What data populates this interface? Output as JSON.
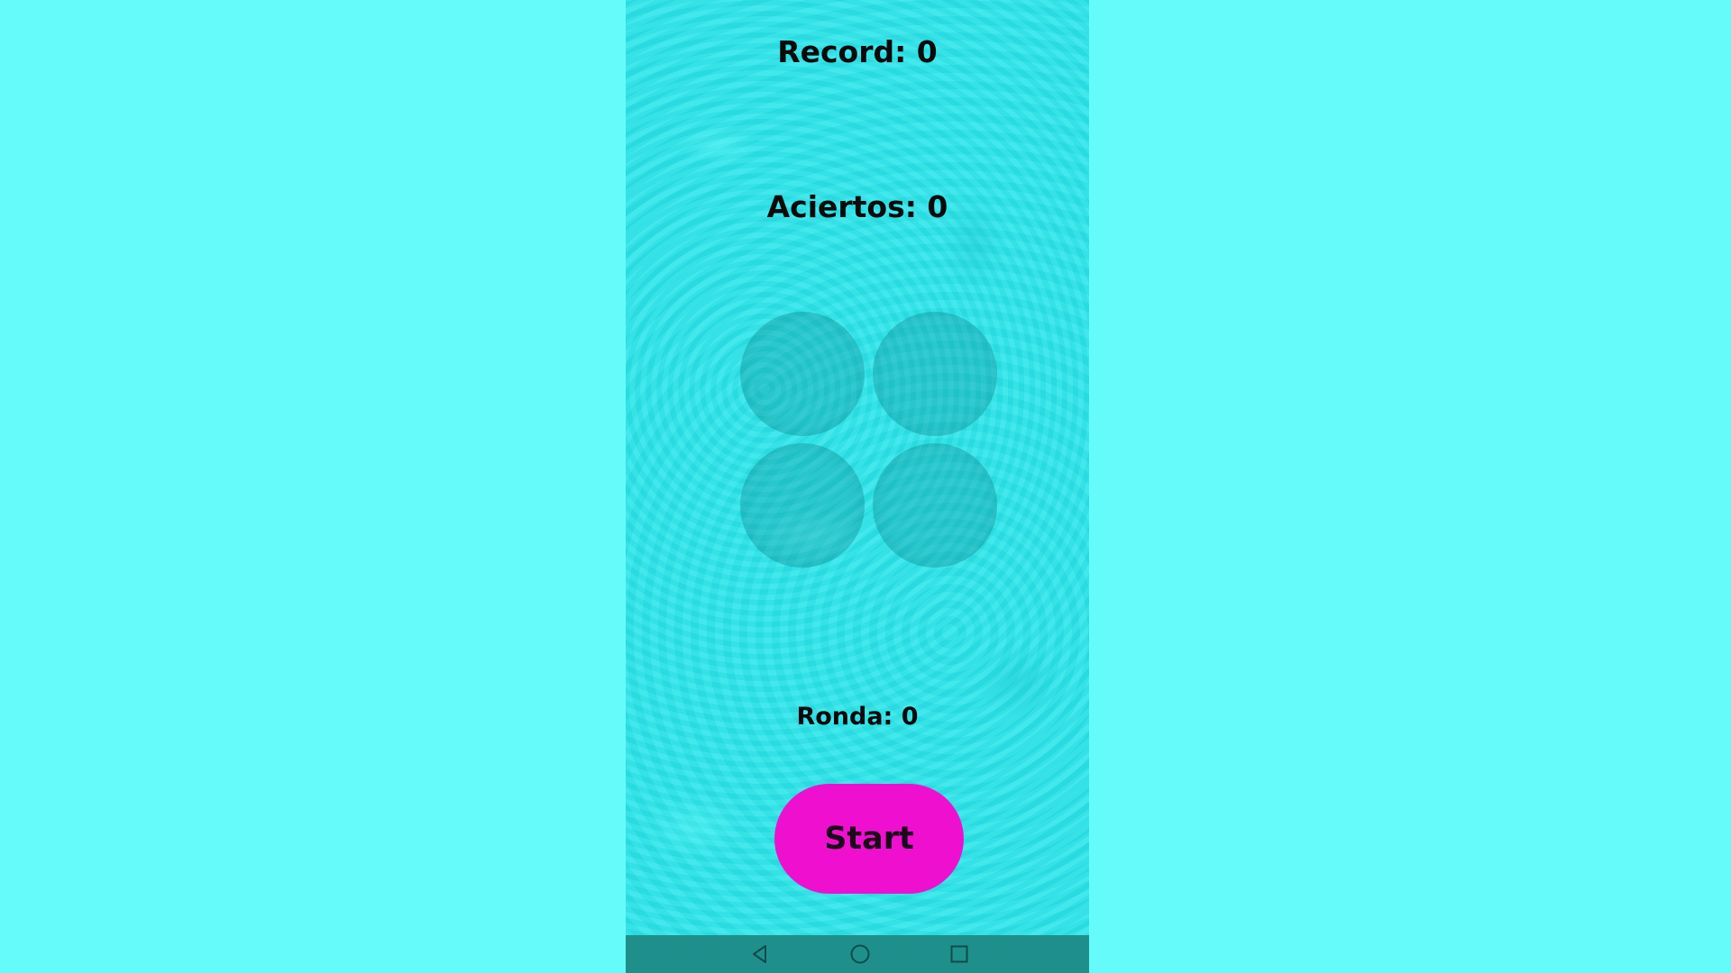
{
  "scoreboard": {
    "record_text": "Record: 0",
    "aciertos_text": "Aciertos: 0",
    "ronda_text": "Ronda: 0"
  },
  "game": {
    "pads": [
      "pad-top-left",
      "pad-top-right",
      "pad-bottom-left",
      "pad-bottom-right"
    ]
  },
  "controls": {
    "start_label": "Start"
  },
  "navigation_bar": {
    "icons": [
      "back-icon",
      "home-icon",
      "recents-icon"
    ]
  },
  "colors": {
    "outer_background": "#66fbfb",
    "app_background": "#2de6ea",
    "start_button": "#ef10cf",
    "navbar": "#1f8f8c"
  }
}
